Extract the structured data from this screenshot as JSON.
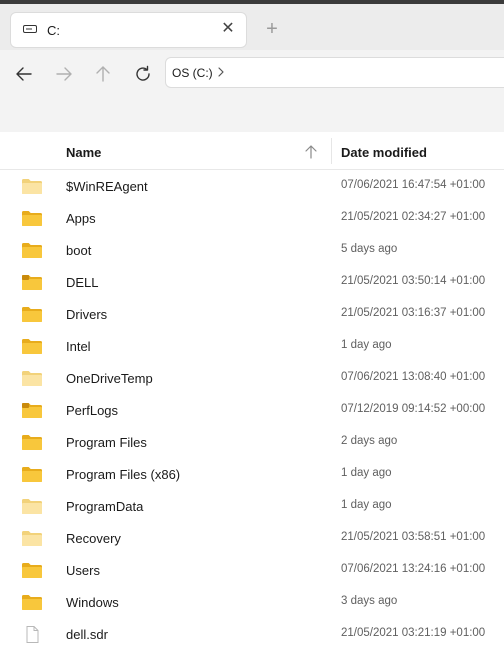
{
  "tab": {
    "title": "C:",
    "close_glyph": "✕",
    "icon": "drive-icon"
  },
  "new_tab_glyph": "+",
  "nav": {
    "back_icon": "arrow-left-icon",
    "forward_icon": "arrow-right-icon",
    "up_icon": "arrow-up-icon",
    "refresh_icon": "refresh-icon"
  },
  "address": {
    "crumb": "OS (C:)"
  },
  "columns": {
    "name": "Name",
    "date": "Date modified",
    "sort": "ascending"
  },
  "files": [
    {
      "name": "$WinREAgent",
      "date": "07/06/2021 16:47:54 +01:00",
      "type": "folder-light"
    },
    {
      "name": "Apps",
      "date": "21/05/2021 02:34:27 +01:00",
      "type": "folder"
    },
    {
      "name": "boot",
      "date": "5 days ago",
      "type": "folder"
    },
    {
      "name": "DELL",
      "date": "21/05/2021 03:50:14 +01:00",
      "type": "folder-dark"
    },
    {
      "name": "Drivers",
      "date": "21/05/2021 03:16:37 +01:00",
      "type": "folder"
    },
    {
      "name": "Intel",
      "date": "1 day ago",
      "type": "folder"
    },
    {
      "name": "OneDriveTemp",
      "date": "07/06/2021 13:08:40 +01:00",
      "type": "folder-light"
    },
    {
      "name": "PerfLogs",
      "date": "07/12/2019 09:14:52 +00:00",
      "type": "folder-dark"
    },
    {
      "name": "Program Files",
      "date": "2 days ago",
      "type": "folder"
    },
    {
      "name": "Program Files (x86)",
      "date": "1 day ago",
      "type": "folder"
    },
    {
      "name": "ProgramData",
      "date": "1 day ago",
      "type": "folder-light"
    },
    {
      "name": "Recovery",
      "date": "21/05/2021 03:58:51 +01:00",
      "type": "folder-light"
    },
    {
      "name": "Users",
      "date": "07/06/2021 13:24:16 +01:00",
      "type": "folder"
    },
    {
      "name": "Windows",
      "date": "3 days ago",
      "type": "folder"
    },
    {
      "name": "dell.sdr",
      "date": "21/05/2021 03:21:19 +01:00",
      "type": "file"
    }
  ],
  "colors": {
    "folder": "#f8c73c",
    "folder_back": "#e8ac1c",
    "folder_light": "#fbe4a4",
    "folder_light_back": "#f2d27a"
  }
}
